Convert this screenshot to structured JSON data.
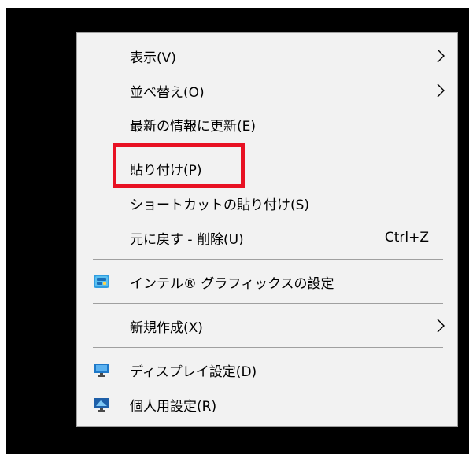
{
  "menu": {
    "items": [
      {
        "label": "表示(V)",
        "has_submenu": true
      },
      {
        "label": "並べ替え(O)",
        "has_submenu": true
      },
      {
        "label": "最新の情報に更新(E)"
      },
      {
        "label": "貼り付け(P)"
      },
      {
        "label": "ショートカットの貼り付け(S)"
      },
      {
        "label": "元に戻す - 削除(U)",
        "shortcut": "Ctrl+Z"
      },
      {
        "label": "インテル® グラフィックスの設定",
        "icon": "intel-graphics-icon"
      },
      {
        "label": "新規作成(X)",
        "has_submenu": true
      },
      {
        "label": "ディスプレイ設定(D)",
        "icon": "display-settings-icon"
      },
      {
        "label": "個人用設定(R)",
        "icon": "personalize-icon"
      }
    ]
  },
  "annotation": {
    "highlight_color": "#e81123"
  },
  "colors": {
    "menu_background": "#f2f2f2",
    "separator": "#a0a0a0",
    "backdrop": "#000000"
  }
}
